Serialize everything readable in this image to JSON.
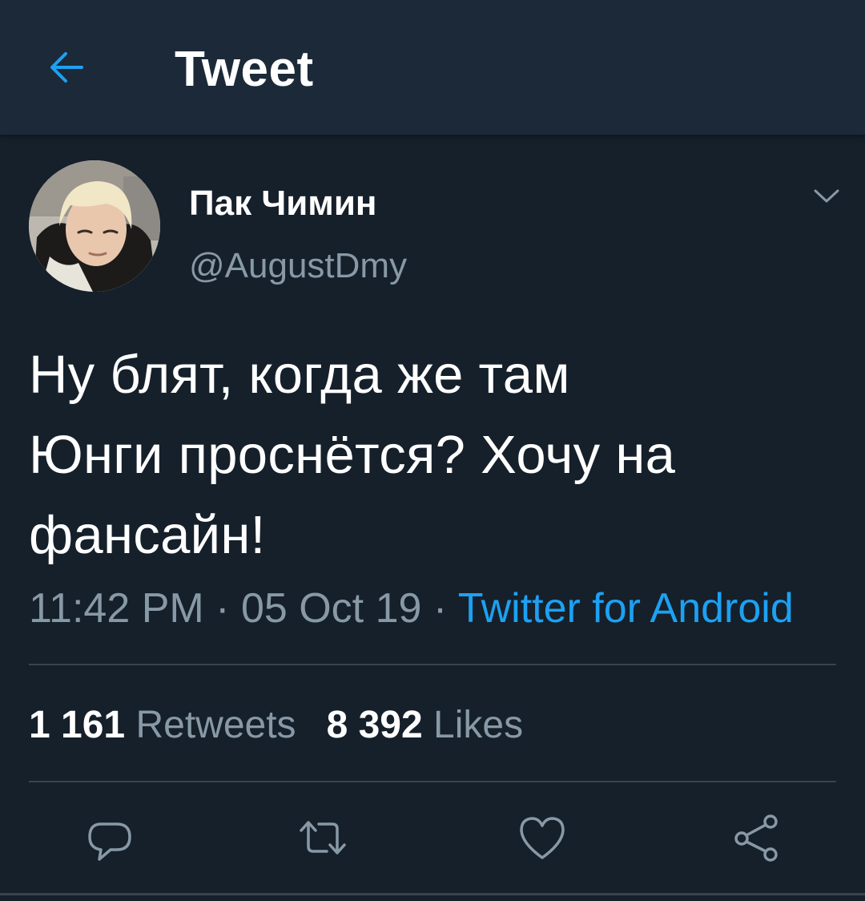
{
  "header": {
    "back_icon": "arrow-left-icon",
    "title": "Tweet"
  },
  "tweet": {
    "author": {
      "display_name": "Пак Чимин",
      "handle": "@AugustDmy",
      "avatar": "profile-photo"
    },
    "menu_icon": "chevron-down-icon",
    "text_lines": [
      "Ну блят, когда же там",
      "Юнги проснётся? Хочу на",
      "фансайн!"
    ],
    "time": "11:42 PM",
    "separator": " · ",
    "date": "05 Oct 19",
    "source": "Twitter for Android"
  },
  "stats": {
    "retweets_count": "1 161",
    "retweets_label": "Retweets",
    "likes_count": "8 392",
    "likes_label": "Likes"
  },
  "actions": [
    {
      "icon": "reply-icon"
    },
    {
      "icon": "retweet-icon"
    },
    {
      "icon": "like-heart-icon"
    },
    {
      "icon": "share-icon"
    }
  ],
  "colors": {
    "background": "#15202b",
    "header": "#1c2938",
    "accent": "#1da1f2",
    "secondary_text": "#8899a6",
    "divider": "#38444d"
  }
}
